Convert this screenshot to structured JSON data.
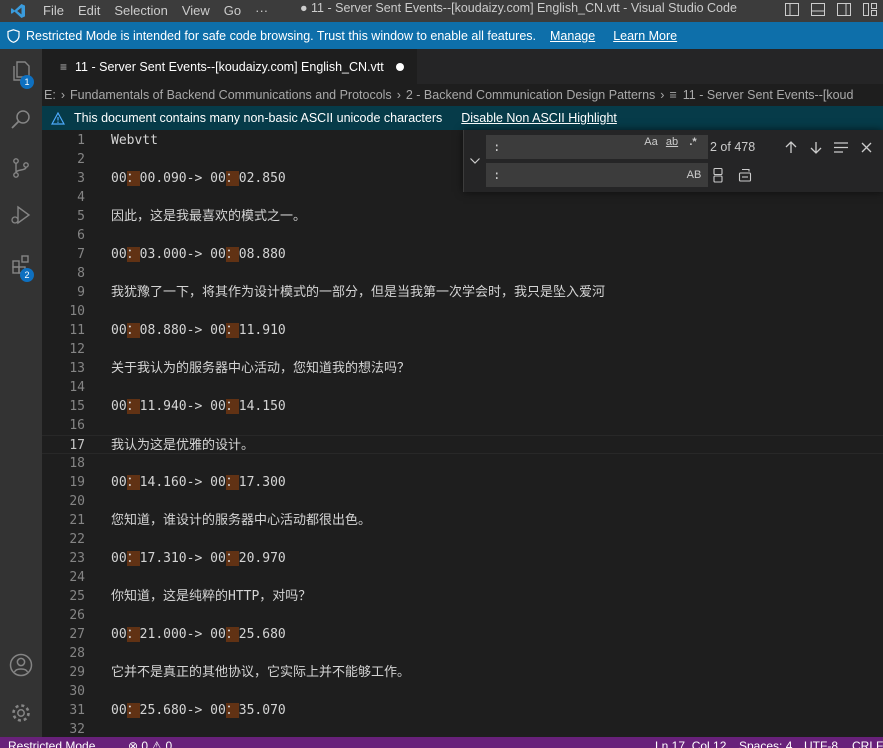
{
  "menu": [
    "File",
    "Edit",
    "Selection",
    "View",
    "Go",
    "···"
  ],
  "window_title": "● 11 - Server Sent Events--[koudaizy.com] English_CN.vtt - Visual Studio Code",
  "banner": {
    "message": "Restricted Mode is intended for safe code browsing. Trust this window to enable all features.",
    "manage": "Manage",
    "learn_more": "Learn More"
  },
  "activity": {
    "explorer_badge": "1",
    "extensions_badge": "2"
  },
  "tab": {
    "label": "11 - Server Sent Events--[koudaizy.com] English_CN.vtt"
  },
  "breadcrumb": {
    "items": [
      "E:",
      "Fundamentals of Backend Communications and Protocols",
      "2 - Backend Communication Design Patterns",
      "11 - Server Sent Events--[koud"
    ]
  },
  "ascii": {
    "message": "This document contains many non-basic ASCII unicode characters",
    "action": "Disable Non ASCII Highlight"
  },
  "find": {
    "find_value": ":",
    "replace_value": ":",
    "match_case": "Aa",
    "whole_word": "ab",
    "regex": ".*",
    "match_count": "2 of 478",
    "preserve_case": "AB"
  },
  "lines": [
    {
      "n": "1",
      "pre": "Webvtt",
      "mid": "",
      "post": ""
    },
    {
      "n": "2",
      "pre": "",
      "mid": "",
      "post": ""
    },
    {
      "n": "3",
      "pre": "00",
      "mid": "00.090-> 00",
      "post": "02.850"
    },
    {
      "n": "4",
      "pre": "",
      "mid": "",
      "post": ""
    },
    {
      "n": "5",
      "pre": "因此，这是我最喜欢的模式之一。",
      "mid": "",
      "post": ""
    },
    {
      "n": "6",
      "pre": "",
      "mid": "",
      "post": ""
    },
    {
      "n": "7",
      "pre": "00",
      "mid": "03.000-> 00",
      "post": "08.880"
    },
    {
      "n": "8",
      "pre": "",
      "mid": "",
      "post": ""
    },
    {
      "n": "9",
      "pre": "我犹豫了一下，将其作为设计模式的一部分，但是当我第一次学会时，我只是坠入爱河",
      "mid": "",
      "post": ""
    },
    {
      "n": "10",
      "pre": "",
      "mid": "",
      "post": ""
    },
    {
      "n": "11",
      "pre": "00",
      "mid": "08.880-> 00",
      "post": "11.910"
    },
    {
      "n": "12",
      "pre": "",
      "mid": "",
      "post": ""
    },
    {
      "n": "13",
      "pre": "关于我认为的服务器中心活动，您知道我的想法吗？",
      "mid": "",
      "post": ""
    },
    {
      "n": "14",
      "pre": "",
      "mid": "",
      "post": ""
    },
    {
      "n": "15",
      "pre": "00",
      "mid": "11.940-> 00",
      "post": "14.150"
    },
    {
      "n": "16",
      "pre": "",
      "mid": "",
      "post": ""
    },
    {
      "n": "17",
      "pre": "我认为这是优雅的设计。",
      "mid": "",
      "post": ""
    },
    {
      "n": "18",
      "pre": "",
      "mid": "",
      "post": ""
    },
    {
      "n": "19",
      "pre": "00",
      "mid": "14.160-> 00",
      "post": "17.300"
    },
    {
      "n": "20",
      "pre": "",
      "mid": "",
      "post": ""
    },
    {
      "n": "21",
      "pre": "您知道，谁设计的服务器中心活动都很出色。",
      "mid": "",
      "post": ""
    },
    {
      "n": "22",
      "pre": "",
      "mid": "",
      "post": ""
    },
    {
      "n": "23",
      "pre": "00",
      "mid": "17.310-> 00",
      "post": "20.970"
    },
    {
      "n": "24",
      "pre": "",
      "mid": "",
      "post": ""
    },
    {
      "n": "25",
      "pre": "你知道，这是纯粹的HTTP，对吗？",
      "mid": "",
      "post": ""
    },
    {
      "n": "26",
      "pre": "",
      "mid": "",
      "post": ""
    },
    {
      "n": "27",
      "pre": "00",
      "mid": "21.000-> 00",
      "post": "25.680"
    },
    {
      "n": "28",
      "pre": "",
      "mid": "",
      "post": ""
    },
    {
      "n": "29",
      "pre": "它并不是真正的其他协议，它实际上并不能够工作。",
      "mid": "",
      "post": ""
    },
    {
      "n": "30",
      "pre": "",
      "mid": "",
      "post": ""
    },
    {
      "n": "31",
      "pre": "00",
      "mid": "25.680-> 00",
      "post": "35.070"
    },
    {
      "n": "32",
      "pre": "",
      "mid": "",
      "post": ""
    }
  ],
  "highlight_char": "：",
  "current_line": "17",
  "status": {
    "mode": "Restricted Mode",
    "problems": "⊗ 0 ⚠ 0",
    "position": "Ln 17, Col 12",
    "spaces": "Spaces: 4",
    "encoding": "UTF-8",
    "eol": "CRLF"
  },
  "colors": {
    "banner": "#0e6faa",
    "status_bar": "#68217a",
    "match_highlight": "#613214"
  }
}
